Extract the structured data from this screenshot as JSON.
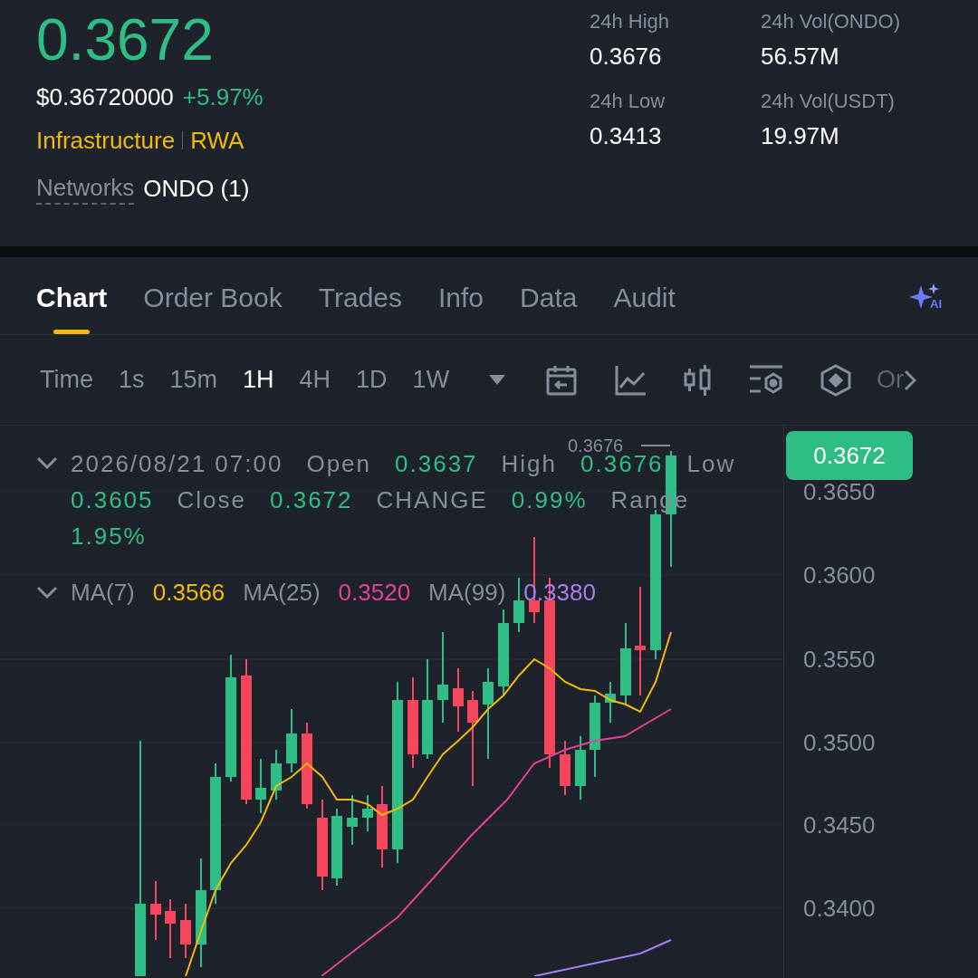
{
  "ticker": {
    "price": "0.3672",
    "usd_price": "$0.36720000",
    "change": "+5.97%",
    "tags": [
      "Infrastructure",
      "RWA"
    ],
    "networks_label": "Networks",
    "networks_value": "ONDO (1)"
  },
  "stats": [
    {
      "label": "24h High",
      "value": "0.3676"
    },
    {
      "label": "24h Vol(ONDO)",
      "value": "56.57M"
    },
    {
      "label": "24h Low",
      "value": "0.3413"
    },
    {
      "label": "24h Vol(USDT)",
      "value": "19.97M"
    }
  ],
  "tabs": [
    {
      "label": "Chart",
      "selected": true
    },
    {
      "label": "Order Book",
      "selected": false
    },
    {
      "label": "Trades",
      "selected": false
    },
    {
      "label": "Info",
      "selected": false
    },
    {
      "label": "Data",
      "selected": false
    },
    {
      "label": "Audit",
      "selected": false
    }
  ],
  "ai_button": "AI",
  "toolbar": {
    "intervals": [
      {
        "label": "Time",
        "selected": false
      },
      {
        "label": "1s",
        "selected": false
      },
      {
        "label": "15m",
        "selected": false
      },
      {
        "label": "1H",
        "selected": true
      },
      {
        "label": "4H",
        "selected": false
      },
      {
        "label": "1D",
        "selected": false
      },
      {
        "label": "1W",
        "selected": false
      }
    ],
    "more": "Or"
  },
  "chart": {
    "high_marker": "0.3676",
    "current_price": "0.3672",
    "ohlc_legend": [
      {
        "text": "2026/08/21 07:00",
        "kind": "label"
      },
      {
        "text": "Open",
        "kind": "label"
      },
      {
        "text": "0.3637",
        "kind": "value"
      },
      {
        "text": "High",
        "kind": "label"
      },
      {
        "text": "0.3676",
        "kind": "value"
      },
      {
        "text": "Low",
        "kind": "label"
      },
      {
        "text": "0.3605",
        "kind": "value"
      },
      {
        "text": "Close",
        "kind": "label"
      },
      {
        "text": "0.3672",
        "kind": "value"
      },
      {
        "text": "CHANGE",
        "kind": "label"
      },
      {
        "text": "0.99%",
        "kind": "value"
      },
      {
        "text": "Range",
        "kind": "label"
      },
      {
        "text": "1.95%",
        "kind": "value"
      }
    ],
    "ma_legend": [
      {
        "label": "MA(7)",
        "value": "0.3566",
        "color": "#f0b90b"
      },
      {
        "label": "MA(25)",
        "value": "0.3520",
        "color": "#e6409a"
      },
      {
        "label": "MA(99)",
        "value": "0.3380",
        "color": "#a77ef0"
      }
    ],
    "axis_labels": [
      "0.3650",
      "0.3600",
      "0.3550",
      "0.3500",
      "0.3450",
      "0.3400"
    ]
  }
}
